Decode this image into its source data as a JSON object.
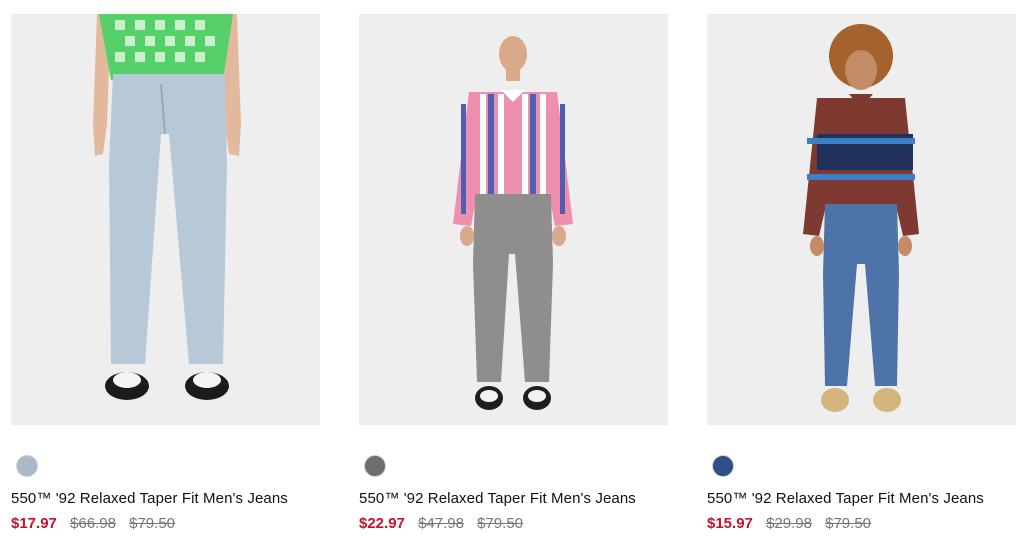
{
  "products": [
    {
      "name": "550™ '92 Relaxed Taper Fit Men's Jeans",
      "swatch_color": "#a9b9c8",
      "sale_price": "$17.97",
      "prev_price": "$66.98",
      "list_price": "$79.50",
      "image": "product-photo-light-wash-jeans"
    },
    {
      "name": "550™ '92 Relaxed Taper Fit Men's Jeans",
      "swatch_color": "#6e6e6e",
      "sale_price": "$22.97",
      "prev_price": "$47.98",
      "list_price": "$79.50",
      "image": "product-photo-grey-jeans"
    },
    {
      "name": "550™ '92 Relaxed Taper Fit Men's Jeans",
      "swatch_color": "#2f4f86",
      "sale_price": "$15.97",
      "prev_price": "$29.98",
      "list_price": "$79.50",
      "image": "product-photo-medium-wash-jeans"
    }
  ],
  "colors": {
    "sale": "#c41230",
    "strikethrough": "#757575",
    "image_bg": "#eeeeee"
  }
}
